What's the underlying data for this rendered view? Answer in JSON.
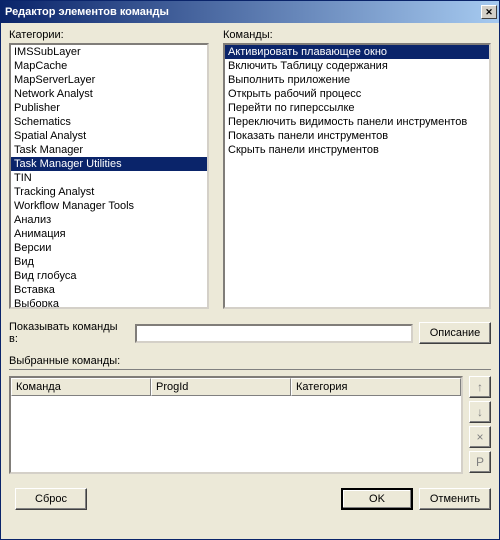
{
  "window": {
    "title": "Редактор элементов команды"
  },
  "labels": {
    "categories": "Категории:",
    "commands": "Команды:",
    "show_commands_in": "Показывать команды в:",
    "selected_commands": "Выбранные команды:"
  },
  "categories": {
    "items": [
      "IMSSubLayer",
      "MapCache",
      "MapServerLayer",
      "Network Analyst",
      "Publisher",
      "Schematics",
      "Spatial Analyst",
      "Task Manager",
      "Task Manager Utilities",
      "TIN",
      "Tracking Analyst",
      "Workflow Manager Tools",
      "Анализ",
      "Анимация",
      "Версии",
      "Вид",
      "Вид глобуса",
      "Вставка",
      "Выборка"
    ],
    "selected_index": 8
  },
  "commands": {
    "items": [
      "Активировать плавающее окно",
      "Включить Таблицу содержания",
      "Выполнить приложение",
      "Открыть рабочий процесс",
      "Перейти по гиперссылке",
      "Переключить видимость панели инструментов",
      "Показать панели инструментов",
      "Скрыть панели инструментов"
    ],
    "selected_index": 0
  },
  "show_in_value": "",
  "table": {
    "columns": {
      "command": "Команда",
      "progid": "ProgId",
      "category": "Категория"
    },
    "rows": []
  },
  "buttons": {
    "description": "Описание",
    "reset": "Сброс",
    "ok": "OK",
    "cancel": "Отменить",
    "up": "↑",
    "down": "↓",
    "remove": "×",
    "p": "P"
  }
}
